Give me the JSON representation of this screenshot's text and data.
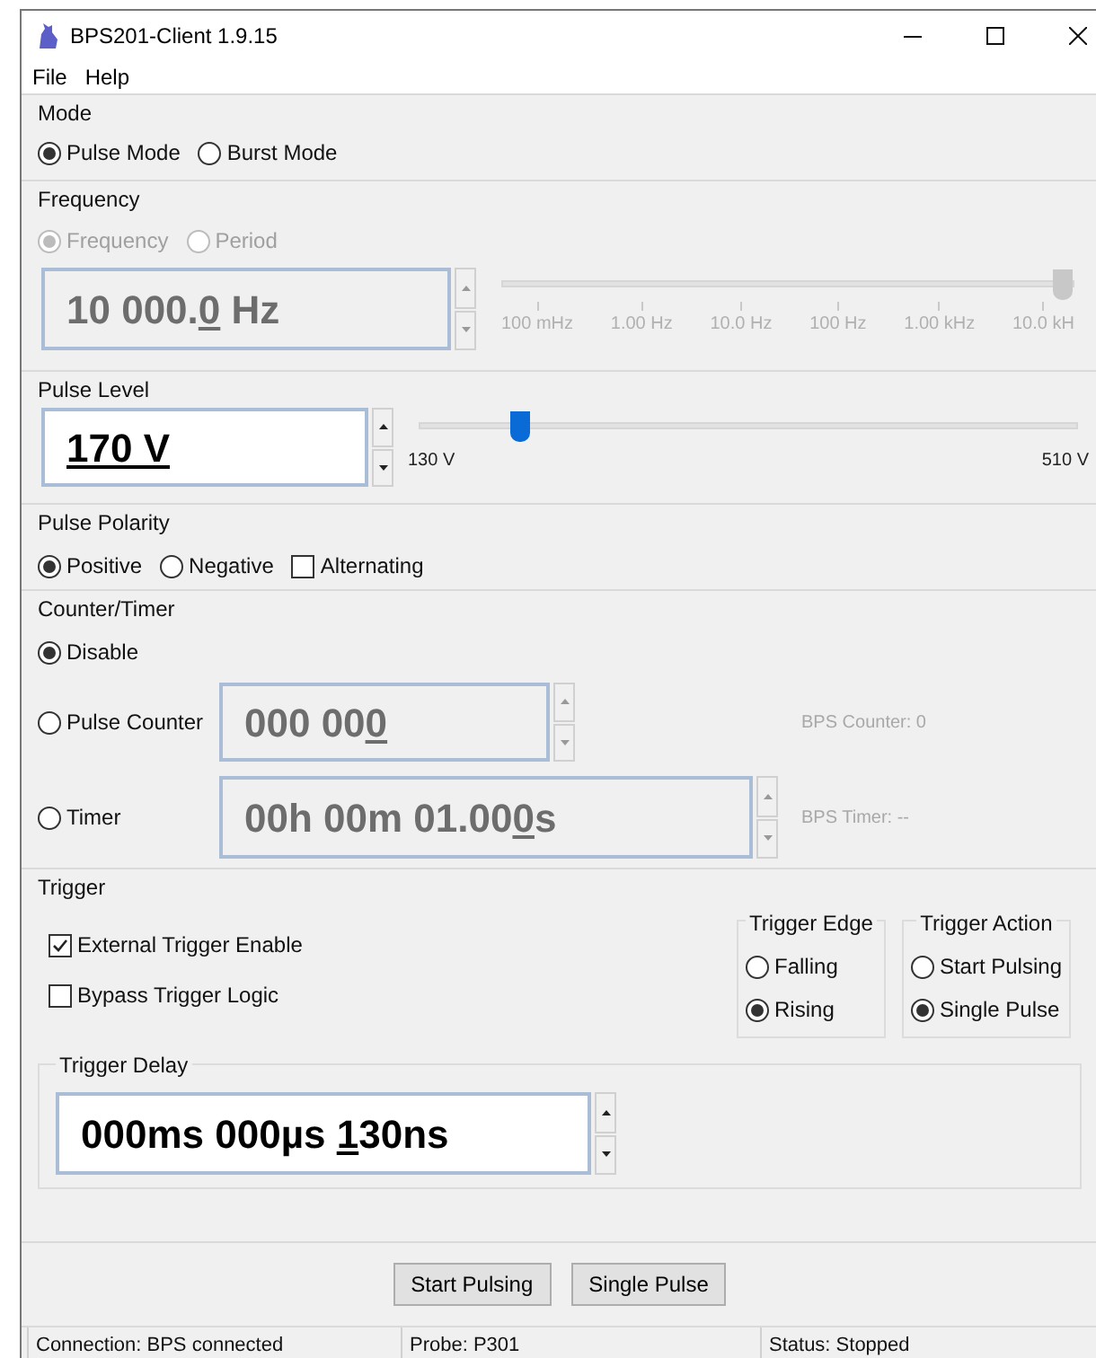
{
  "window": {
    "title": "BPS201-Client 1.9.15"
  },
  "menu": [
    "File",
    "Help"
  ],
  "mode": {
    "title": "Mode",
    "options": [
      {
        "label": "Pulse Mode",
        "selected": true
      },
      {
        "label": "Burst Mode",
        "selected": false
      }
    ]
  },
  "frequency": {
    "title": "Frequency",
    "disabled": true,
    "options": [
      {
        "label": "Frequency",
        "selected": true
      },
      {
        "label": "Period",
        "selected": false
      }
    ],
    "spinbox": {
      "disabled": true,
      "parts": [
        {
          "text": "10 000.",
          "underlined": false
        },
        {
          "text": "0",
          "underlined": true
        },
        {
          "text": " Hz",
          "underlined": false
        }
      ]
    },
    "slider": {
      "level": 1,
      "ticks": [
        "100 mHz",
        "1.00 Hz",
        "10.0 Hz",
        "100 Hz",
        "1.00 kHz",
        "10.0 kH"
      ]
    }
  },
  "pulse_level": {
    "title": "Pulse Level",
    "spinbox": {
      "disabled": false,
      "parts": [
        {
          "text": "170 V",
          "underlined": true
        }
      ]
    },
    "slider": {
      "level": 0.14,
      "min_label": "130 V",
      "max_label": "510 V"
    }
  },
  "polarity": {
    "title": "Pulse Polarity",
    "options": [
      {
        "kind": "radio",
        "label": "Positive",
        "selected": true
      },
      {
        "kind": "radio",
        "label": "Negative",
        "selected": false
      },
      {
        "kind": "checkbox",
        "label": "Alternating",
        "selected": false
      }
    ]
  },
  "counter_timer": {
    "title": "Counter/Timer",
    "rows": [
      {
        "label": "Disable",
        "selected": true
      },
      {
        "label": "Pulse Counter",
        "selected": false,
        "spinbox": {
          "disabled": true,
          "parts": [
            {
              "text": "000 00",
              "underlined": false
            },
            {
              "text": "0",
              "underlined": true
            }
          ]
        },
        "reading": "BPS Counter: 0"
      },
      {
        "label": "Timer",
        "selected": false,
        "spinbox": {
          "disabled": true,
          "parts": [
            {
              "text": "00h 00m 01.00",
              "underlined": false
            },
            {
              "text": "0",
              "underlined": true
            },
            {
              "text": "s",
              "underlined": false
            }
          ]
        },
        "reading": "BPS Timer: --"
      }
    ]
  },
  "trigger": {
    "title": "Trigger",
    "checks": [
      {
        "label": "External Trigger Enable",
        "checked": true
      },
      {
        "label": "Bypass Trigger Logic",
        "checked": false
      }
    ],
    "edge": {
      "title": "Trigger Edge",
      "options": [
        {
          "label": "Falling",
          "selected": false
        },
        {
          "label": "Rising",
          "selected": true
        }
      ]
    },
    "action": {
      "title": "Trigger Action",
      "options": [
        {
          "label": "Start Pulsing",
          "selected": false
        },
        {
          "label": "Single Pulse",
          "selected": true
        }
      ]
    },
    "delay": {
      "title": "Trigger Delay",
      "spinbox": {
        "disabled": false,
        "parts": [
          {
            "text": "000ms 000µs ",
            "underlined": false
          },
          {
            "text": "1",
            "underlined": true
          },
          {
            "text": "30ns",
            "underlined": false
          }
        ]
      }
    }
  },
  "buttons": [
    "Start Pulsing",
    "Single Pulse"
  ],
  "status_bar": [
    "Connection: BPS connected",
    "Probe: P301",
    "Status: Stopped"
  ]
}
